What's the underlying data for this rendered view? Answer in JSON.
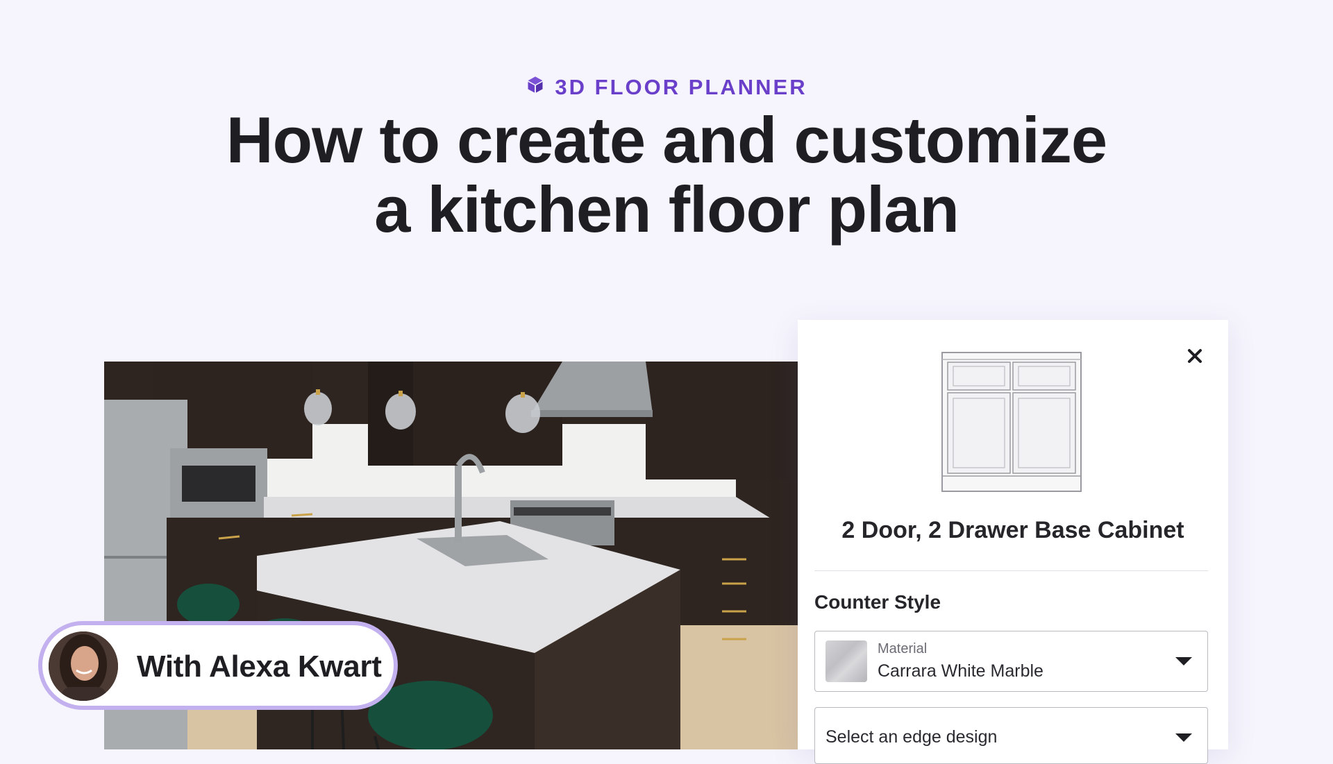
{
  "header": {
    "eyebrow": "3D FLOOR PLANNER",
    "eyebrow_icon": "cube-icon",
    "title_line1": "How to create and customize",
    "title_line2": "a kitchen floor plan"
  },
  "panel": {
    "product_title": "2 Door, 2 Drawer Base Cabinet",
    "close_icon": "close-icon",
    "section_label": "Counter Style",
    "material": {
      "label": "Material",
      "value": "Carrara White Marble"
    },
    "edge": {
      "placeholder": "Select an edge design"
    }
  },
  "presenter": {
    "name": "With Alexa Kwart"
  },
  "colors": {
    "background": "#f6f5fd",
    "accent": "#6a3fc9",
    "pill_border": "#c3b1ef",
    "title": "#1f1f23"
  }
}
